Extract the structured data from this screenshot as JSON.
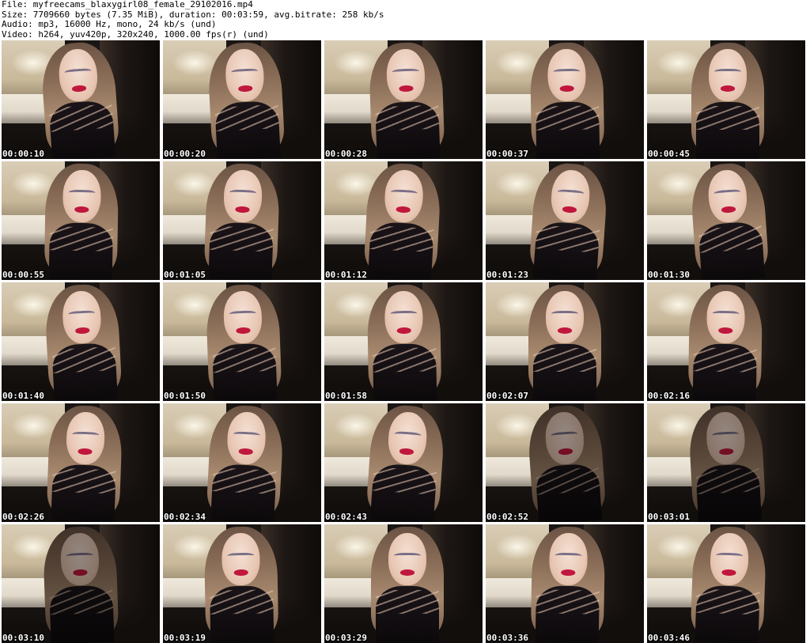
{
  "header": {
    "file_line": "File: myfreecams_blaxygirl08_female_29102016.mp4",
    "size_line": "Size: 7709660 bytes (7.35 MiB), duration: 00:03:59, avg.bitrate: 258 kb/s",
    "audio_line": "Audio: mp3, 16000 Hz, mono, 24 kb/s (und)",
    "video_line": "Video: h264, yuv420p, 320x240, 1000.00 fps(r) (und)"
  },
  "thumbnails": [
    {
      "timestamp": "00:00:10"
    },
    {
      "timestamp": "00:00:20"
    },
    {
      "timestamp": "00:00:28"
    },
    {
      "timestamp": "00:00:37"
    },
    {
      "timestamp": "00:00:45"
    },
    {
      "timestamp": "00:00:55"
    },
    {
      "timestamp": "00:01:05"
    },
    {
      "timestamp": "00:01:12"
    },
    {
      "timestamp": "00:01:23"
    },
    {
      "timestamp": "00:01:30"
    },
    {
      "timestamp": "00:01:40"
    },
    {
      "timestamp": "00:01:50"
    },
    {
      "timestamp": "00:01:58"
    },
    {
      "timestamp": "00:02:07"
    },
    {
      "timestamp": "00:02:16"
    },
    {
      "timestamp": "00:02:26"
    },
    {
      "timestamp": "00:02:34"
    },
    {
      "timestamp": "00:02:43"
    },
    {
      "timestamp": "00:02:52"
    },
    {
      "timestamp": "00:03:01"
    },
    {
      "timestamp": "00:03:10"
    },
    {
      "timestamp": "00:03:19"
    },
    {
      "timestamp": "00:03:29"
    },
    {
      "timestamp": "00:03:36"
    },
    {
      "timestamp": "00:03:46"
    }
  ],
  "colors": {
    "background": "#ffffff",
    "header_text": "#000000",
    "timestamp_text": "#ffffff",
    "timestamp_outline": "#000000",
    "lip_color": "#c0173d"
  }
}
